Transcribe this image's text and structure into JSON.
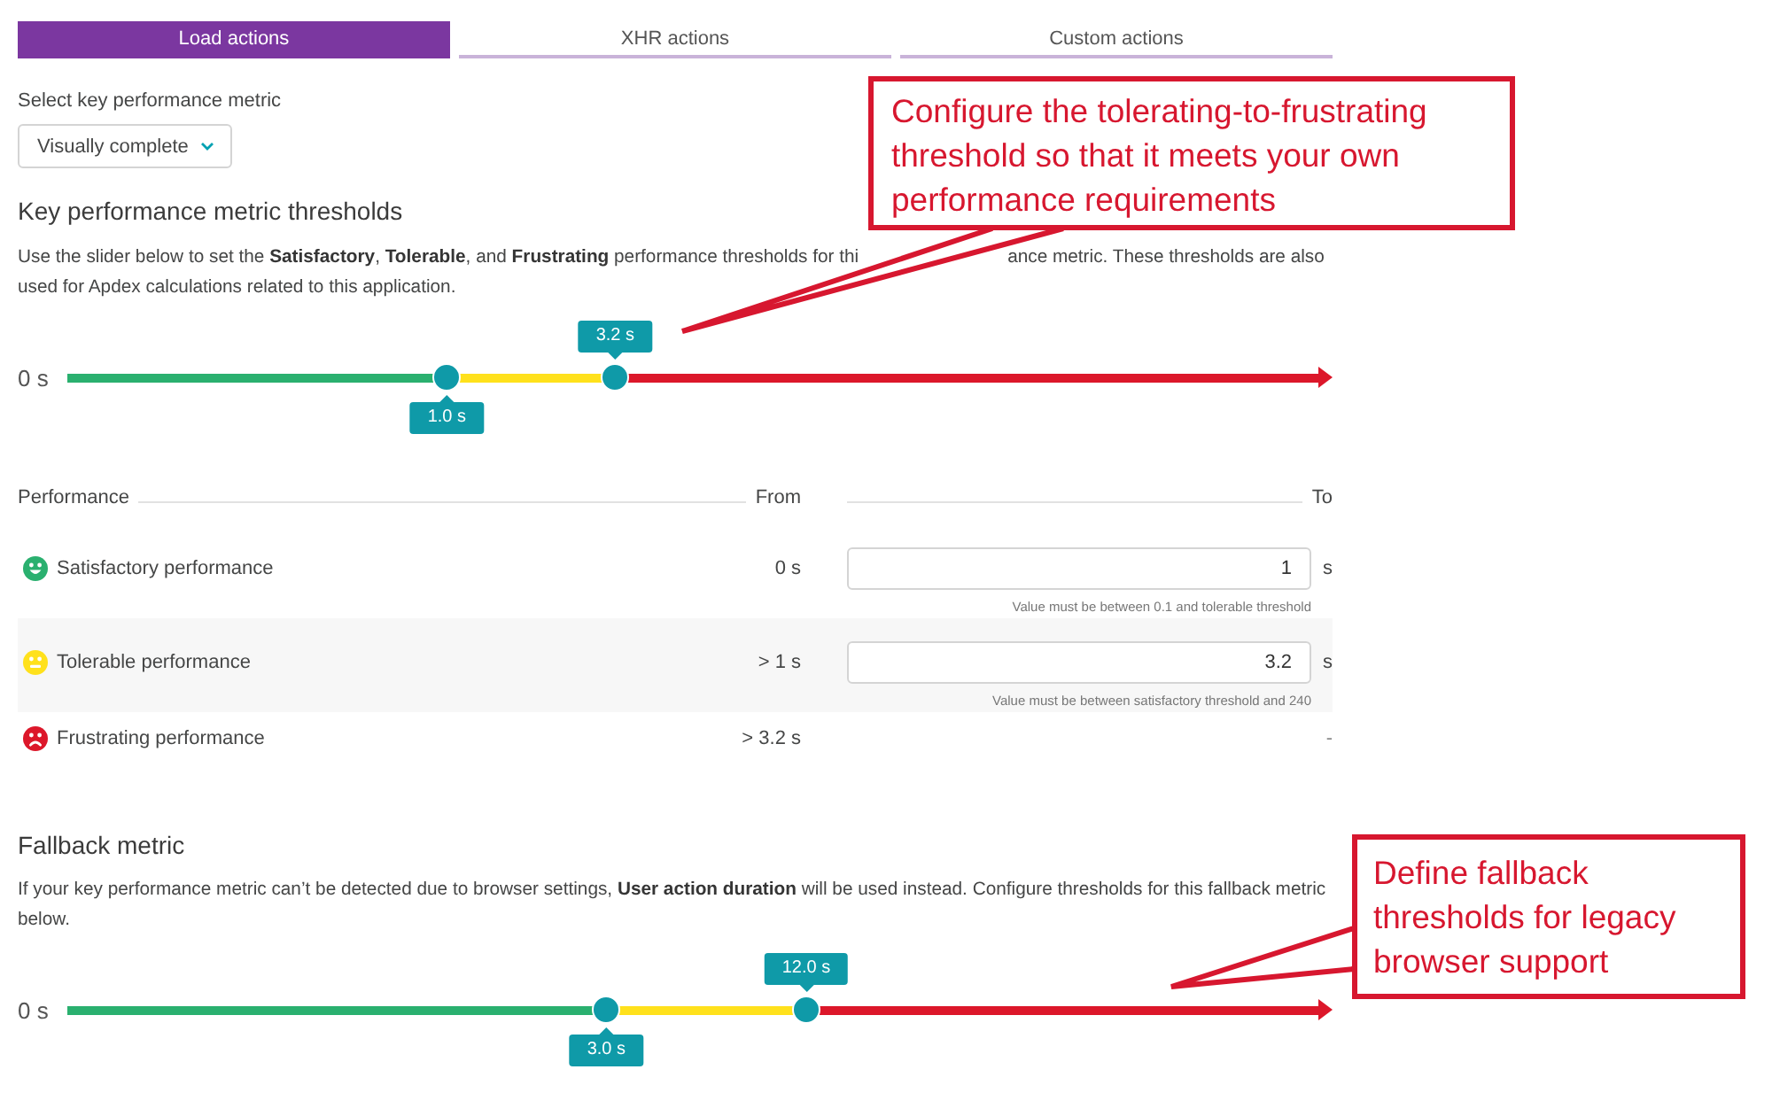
{
  "tabs": [
    {
      "label": "Load actions",
      "selected": true
    },
    {
      "label": "XHR actions",
      "selected": false
    },
    {
      "label": "Custom actions",
      "selected": false
    }
  ],
  "metric_select": {
    "label": "Select key performance metric",
    "value": "Visually complete"
  },
  "key_metric_thresholds": {
    "title": "Key performance metric thresholds",
    "description": [
      "Use the slider below to set the **Satisfactory**, **Tolerable**, and **Frustrating** performance thresholds for thi",
      "ance metric. These thresholds are also",
      "used for Apdex calculations related to this application."
    ],
    "slider": {
      "min_label": "0 s",
      "thumbs": [
        {
          "value": "1.0 s",
          "level": 0.3
        },
        {
          "value": "3.2 s",
          "level": 0.433
        }
      ]
    }
  },
  "performance_table": {
    "columns": [
      "Performance",
      "From",
      "To"
    ],
    "rows": [
      {
        "kind": "satisfactory",
        "color": "#2ab06f",
        "name": "Satisfactory performance",
        "from": "0 s",
        "to_value": "1",
        "unit": "s",
        "hint": "Value must be between 0.1 and tolerable threshold"
      },
      {
        "kind": "tolerable",
        "color": "#ffe11c",
        "name": "Tolerable performance",
        "from": "> 1 s",
        "to_value": "3.2",
        "unit": "s",
        "hint": "Value must be between satisfactory threshold and 240"
      },
      {
        "kind": "frustrating",
        "color": "#dc172a",
        "name": "Frustrating performance",
        "from": "> 3.2 s",
        "to": "-"
      }
    ]
  },
  "fallback_metric": {
    "title": "Fallback metric",
    "description": "If your key performance metric can’t be detected due to browser settings, **User action duration** will be used instead. Configure thresholds for this fallback metric below.",
    "slider": {
      "min_label": "0 s",
      "thumbs": [
        {
          "value": "3.0 s",
          "level": 0.426
        },
        {
          "value": "12.0 s",
          "level": 0.584
        }
      ]
    }
  },
  "callouts": [
    {
      "text": "Configure the tolerating-to-frustrating threshold so that it meets your own performance requirements"
    },
    {
      "text": "Define fallback thresholds for legacy browser support"
    }
  ]
}
